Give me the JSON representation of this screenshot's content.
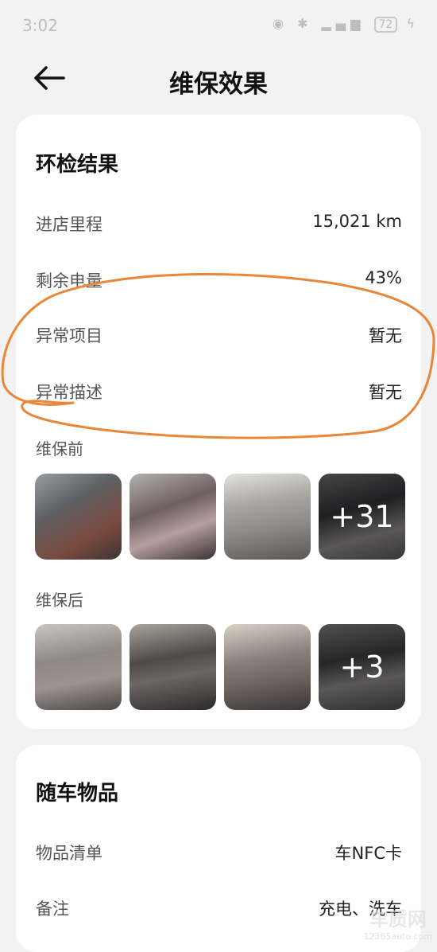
{
  "status_bar": {
    "time": "3:02",
    "battery": "72"
  },
  "header": {
    "title": "维保效果"
  },
  "inspection": {
    "title": "环检结果",
    "rows": [
      {
        "label": "进店里程",
        "value": "15,021 km"
      },
      {
        "label": "剩余电量",
        "value": "43%"
      },
      {
        "label": "异常项目",
        "value": "暂无"
      },
      {
        "label": "异常描述",
        "value": "暂无"
      }
    ]
  },
  "before": {
    "label": "维保前",
    "more": "+31"
  },
  "after": {
    "label": "维保后",
    "more": "+3"
  },
  "belongings": {
    "title": "随车物品",
    "rows": [
      {
        "label": "物品清单",
        "value": "车NFC卡"
      },
      {
        "label": "备注",
        "value": "充电、洗车"
      }
    ]
  },
  "watermark": {
    "main": "车质网",
    "sub": "12365auto.com"
  },
  "colors": {
    "annotation": "#e8873a",
    "background": "#f2f2f2"
  }
}
